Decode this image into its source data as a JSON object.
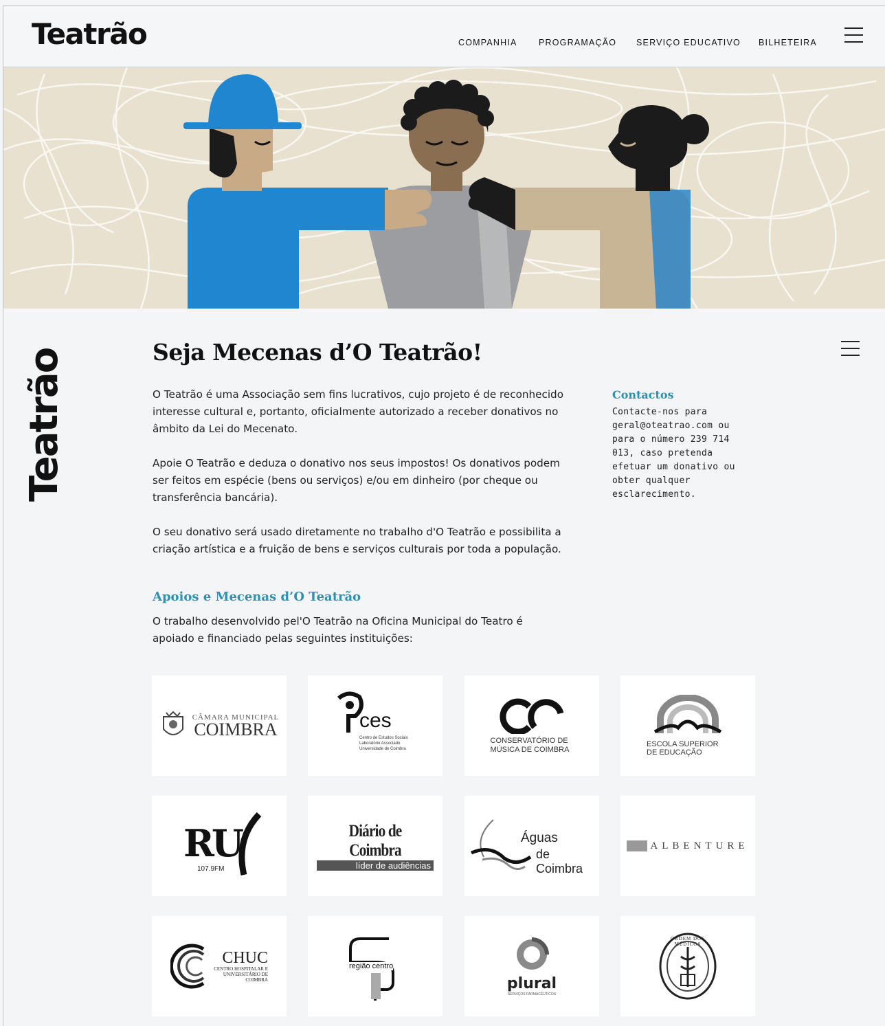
{
  "header": {
    "logo": "Teatrão",
    "nav": [
      "COMPANHIA",
      "PROGRAMAÇÃO",
      "SERVIÇO EDUCATIVO",
      "BILHETEIRA"
    ]
  },
  "hero_image": "illustration of three figures embracing",
  "side_logo": "Teatrão",
  "main": {
    "title": "Seja Mecenas d’O Teatrão!",
    "paragraphs": [
      "O Teatrão é uma Associação sem fins lucrativos, cujo projeto é de reconhecido interesse cultural e, portanto, oficialmente autorizado a receber donativos no âmbito da Lei do Mecenato.",
      "Apoie O Teatrão e deduza o donativo nos seus impostos! Os donativos podem ser feitos em espécie (bens ou serviços) e/ou em dinheiro (por cheque ou transferência bancária).",
      "O seu donativo será usado diretamente no trabalho d'O Teatrão e possibilita a criação artística e a fruição de bens e serviços culturais por toda a população."
    ],
    "supporters_title": "Apoios e Mecenas d’O Teatrão",
    "supporters_text": "O trabalho desenvolvido pel'O Teatrão na Oficina Municipal do Teatro é apoiado e financiado pelas seguintes instituições:"
  },
  "contacts": {
    "title": "Contactos",
    "text": "Contacte-nos para geral@oteatrao.com ou para o número 239 714 013, caso pretenda efetuar um donativo ou obter qualquer esclarecimento."
  },
  "sponsors": [
    {
      "name": "CÂMARA MUNICIPAL",
      "sub": "COIMBRA"
    },
    {
      "name": "ces",
      "sub": "Centro de Estudos Sociais Laboratório Associado Universidade de Coimbra"
    },
    {
      "name": "CONSERVATÓRIO DE",
      "sub": "MÚSICA DE COIMBRA"
    },
    {
      "name": "ESCOLA SUPERIOR",
      "sub": "DE EDUCAÇÃO"
    },
    {
      "name": "RU",
      "sub": "107.9FM"
    },
    {
      "name": "Diário de Coimbra",
      "sub": "líder de audiências"
    },
    {
      "name": "Águas",
      "sub": "de Coimbra"
    },
    {
      "name": "ALBENTURE",
      "sub": ""
    },
    {
      "name": "CHUC",
      "sub": "CENTRO HOSPITALAR E UNIVERSITÁRIO DE COIMBRA"
    },
    {
      "name": "região centro",
      "sub": ""
    },
    {
      "name": "plural",
      "sub": "SERVIÇOS FARMACÊUTICOS"
    },
    {
      "name": "ORDEM DOS MÉDICOS",
      "sub": ""
    }
  ]
}
